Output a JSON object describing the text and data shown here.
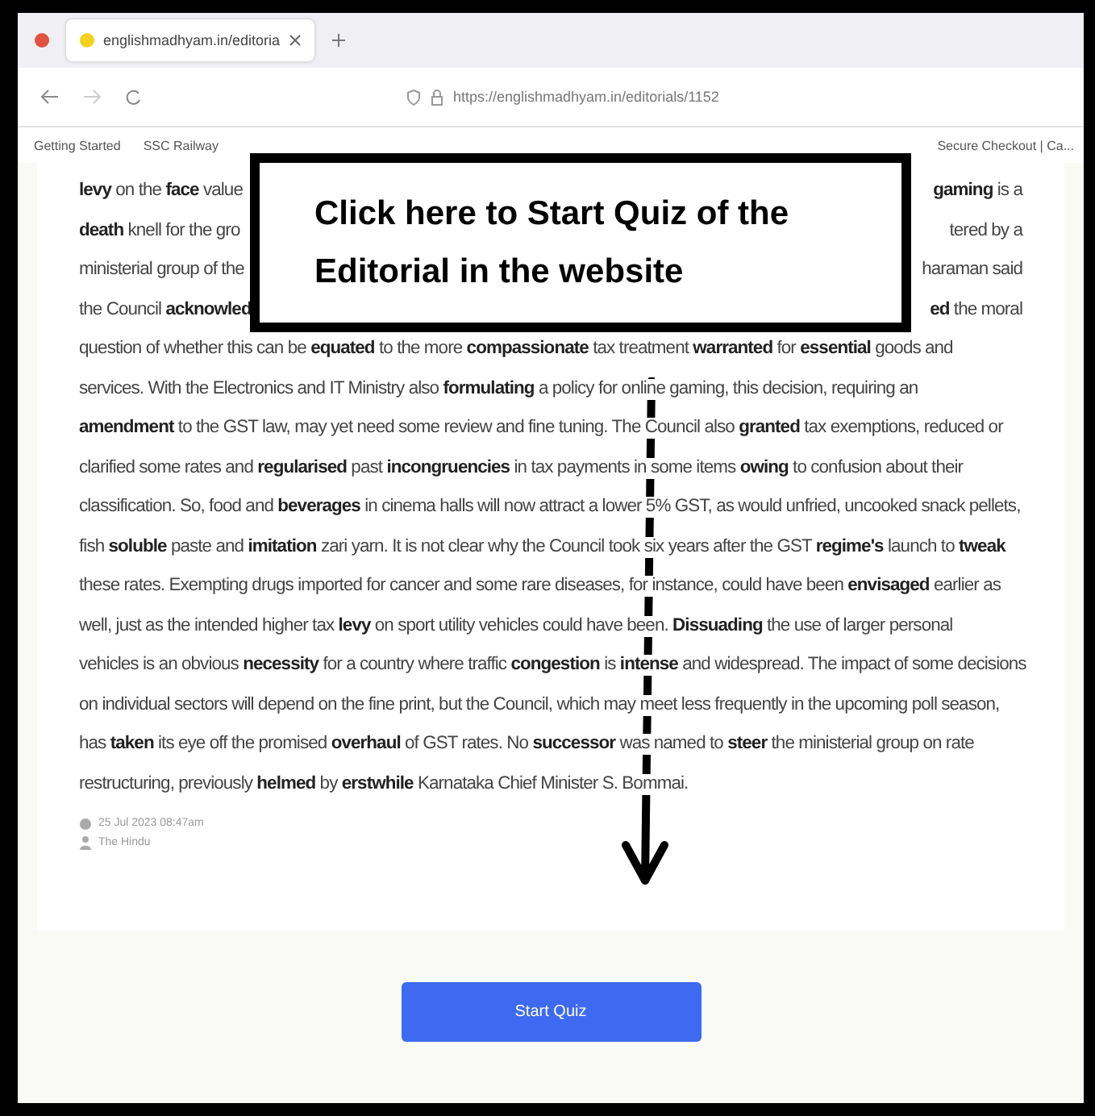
{
  "browser": {
    "tab": {
      "title": "englishmadhyam.in/editoria",
      "selected": true
    },
    "address": "https://englishmadhyam.in/editorials/1152",
    "bookmarks": [
      "Getting Started",
      "SSC Railway",
      "Secure Checkout | Ca..."
    ]
  },
  "article": {
    "covered_lines": [
      {
        "left": "**levy** on the **face** value",
        "right": "**gaming** is a"
      },
      {
        "left": "**death** knell for the gro",
        "right": "tered by a"
      },
      {
        "left": "ministerial group of the",
        "right": "haraman said"
      },
      {
        "left": "the Council **acknowled**",
        "right": "**ed** the moral"
      }
    ],
    "lines": [
      "question of whether this can be **equated** to the more **compassionate** tax treatment **warranted** for **essential** goods and",
      "services. With the Electronics and IT Ministry also **formulating** a policy for online gaming, this decision, requiring an",
      "**amendment** to the GST law, may yet need some review and fine tuning. The Council also **granted** tax exemptions, reduced or",
      "clarified some rates and **regularised** past **incongruencies** in tax payments in some items **owing** to confusion about their",
      "classification. So, food and **beverages** in cinema halls will now attract a lower 5% GST, as would unfried, uncooked snack pellets,",
      "fish **soluble** paste and **imitation** zari yarn. It is not clear why the Council took six years after the GST **regime's** launch to **tweak**",
      "these rates. Exempting drugs imported for cancer and some rare diseases, for instance, could have been **envisaged** earlier as",
      "well, just as the intended higher tax **levy** on sport utility vehicles could have been. **Dissuading** the use of larger personal",
      "vehicles is an obvious **necessity** for a country where traffic **congestion** is **intense** and widespread. The impact of some decisions",
      "on individual sectors will depend on the fine print, but the Council, which may meet less frequently in the upcoming poll season,",
      "has **taken** its eye off the promised **overhaul** of GST rates. No **successor** was named to **steer** the ministerial group on rate",
      "restructuring, previously **helmed** by **erstwhile** Karnataka Chief Minister S. Bommai."
    ],
    "date": "25 Jul 2023 08:47am",
    "source": "The Hindu"
  },
  "start_button": "Start Quiz",
  "callout": {
    "lines": [
      "Click here to Start Quiz of the",
      "Editorial in the website"
    ]
  }
}
